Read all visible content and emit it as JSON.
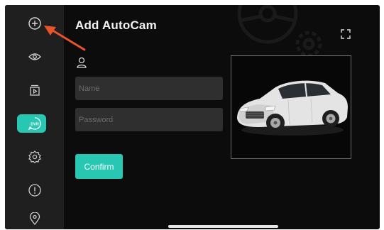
{
  "header": {
    "title": "Add AutoCam"
  },
  "form": {
    "name_placeholder": "Name",
    "password_placeholder": "Password",
    "confirm_label": "Confirm"
  },
  "sidebar": {
    "items": [
      {
        "icon": "add-icon",
        "active": false
      },
      {
        "icon": "eye-icon",
        "active": false
      },
      {
        "icon": "playback-icon",
        "active": false
      },
      {
        "icon": "dvr-icon",
        "label": "DVR",
        "active": true
      },
      {
        "icon": "settings-gear-icon",
        "active": false
      },
      {
        "icon": "info-alert-icon",
        "active": false
      },
      {
        "icon": "location-pin-icon",
        "active": false
      }
    ]
  },
  "colors": {
    "accent": "#27c7b2",
    "sidebar": "#1f1f1f",
    "background": "#0c0c0c",
    "field": "#2f2f2f",
    "annotation_arrow": "#e8532a"
  }
}
